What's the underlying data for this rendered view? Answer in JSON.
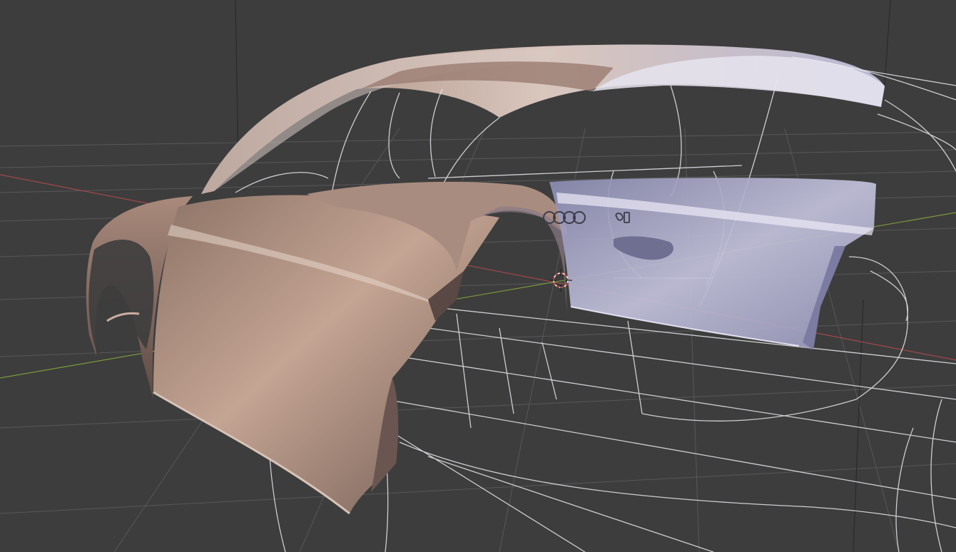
{
  "app": {
    "window_title": ""
  },
  "viewport": {
    "view_mode": "perspective",
    "background_color": "#3d3d3d",
    "grid_color": "#5a5a5a",
    "x_axis_color": "#a3484d",
    "y_axis_color": "#7a9a3a",
    "object_shading": "solid",
    "reference_overlay": "blueprint-lines"
  },
  "scene": {
    "object": "car-body-panels",
    "emblem_rings": 4,
    "badge_text": "",
    "cursor": "3d-cursor-icon"
  }
}
